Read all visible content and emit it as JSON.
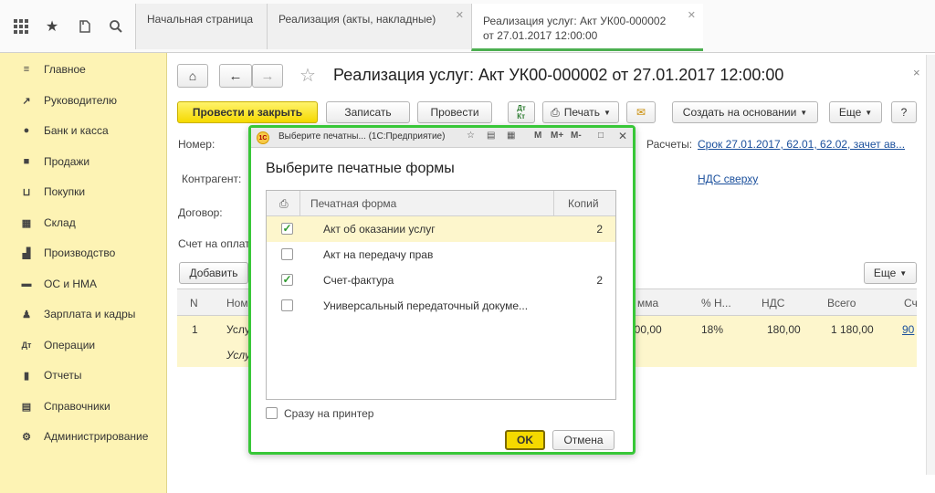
{
  "tabs": [
    {
      "label": "Начальная страница"
    },
    {
      "label": "Реализация (акты, накладные)"
    },
    {
      "label": "Реализация услуг: Акт УК00-000002",
      "label2": "от 27.01.2017 12:00:00"
    }
  ],
  "sidebar": {
    "items": [
      {
        "label": "Главное"
      },
      {
        "label": "Руководителю"
      },
      {
        "label": "Банк и касса"
      },
      {
        "label": "Продажи"
      },
      {
        "label": "Покупки"
      },
      {
        "label": "Склад"
      },
      {
        "label": "Производство"
      },
      {
        "label": "ОС и НМА"
      },
      {
        "label": "Зарплата и кадры"
      },
      {
        "label": "Операции"
      },
      {
        "label": "Отчеты"
      },
      {
        "label": "Справочники"
      },
      {
        "label": "Администрирование"
      }
    ]
  },
  "document": {
    "title": "Реализация услуг: Акт УК00-000002 от 27.01.2017 12:00:00",
    "toolbar": {
      "post_close": "Провести и закрыть",
      "save": "Записать",
      "post": "Провести",
      "print": "Печать",
      "create_based": "Создать на основании",
      "more": "Еще",
      "help": "?"
    },
    "fields": {
      "number_label": "Номер:",
      "counterparty_label": "Контрагент:",
      "contract_label": "Договор:",
      "invoice_label": "Счет на оплат",
      "settlements_label": "Расчеты:",
      "settlements_link": "Срок 27.01.2017, 62.01, 62.02, зачет ав...",
      "vat_link": "НДС сверху"
    },
    "grid": {
      "add": "Добавить",
      "more": "Еще",
      "columns": [
        "N",
        "Ном",
        "мма",
        "% Н...",
        "НДС",
        "Всего",
        "Сч"
      ],
      "row": {
        "n": "1",
        "name": "Услу",
        "name2": "Услу",
        "sum": "000,00",
        "vat_rate": "18%",
        "vat": "180,00",
        "total": "1 180,00",
        "account": "90"
      }
    }
  },
  "dialog": {
    "title": "Выберите печатны... (1С:Предприятие)",
    "title_icons": [
      "M",
      "M+",
      "M-"
    ],
    "heading": "Выберите печатные формы",
    "col_form": "Печатная форма",
    "col_copies": "Копий",
    "rows": [
      {
        "name": "Акт об оказании услуг",
        "checked": true,
        "copies": "2",
        "mark": "✓"
      },
      {
        "name": "Акт на передачу прав",
        "checked": false,
        "copies": "",
        "mark": ""
      },
      {
        "name": "Счет-фактура",
        "checked": true,
        "copies": "2",
        "mark": "✓"
      },
      {
        "name": "Универсальный передаточный докуме...",
        "checked": false,
        "copies": "",
        "mark": ""
      }
    ],
    "to_printer": "Сразу на принтер",
    "ok": "OK",
    "cancel": "Отмена"
  }
}
